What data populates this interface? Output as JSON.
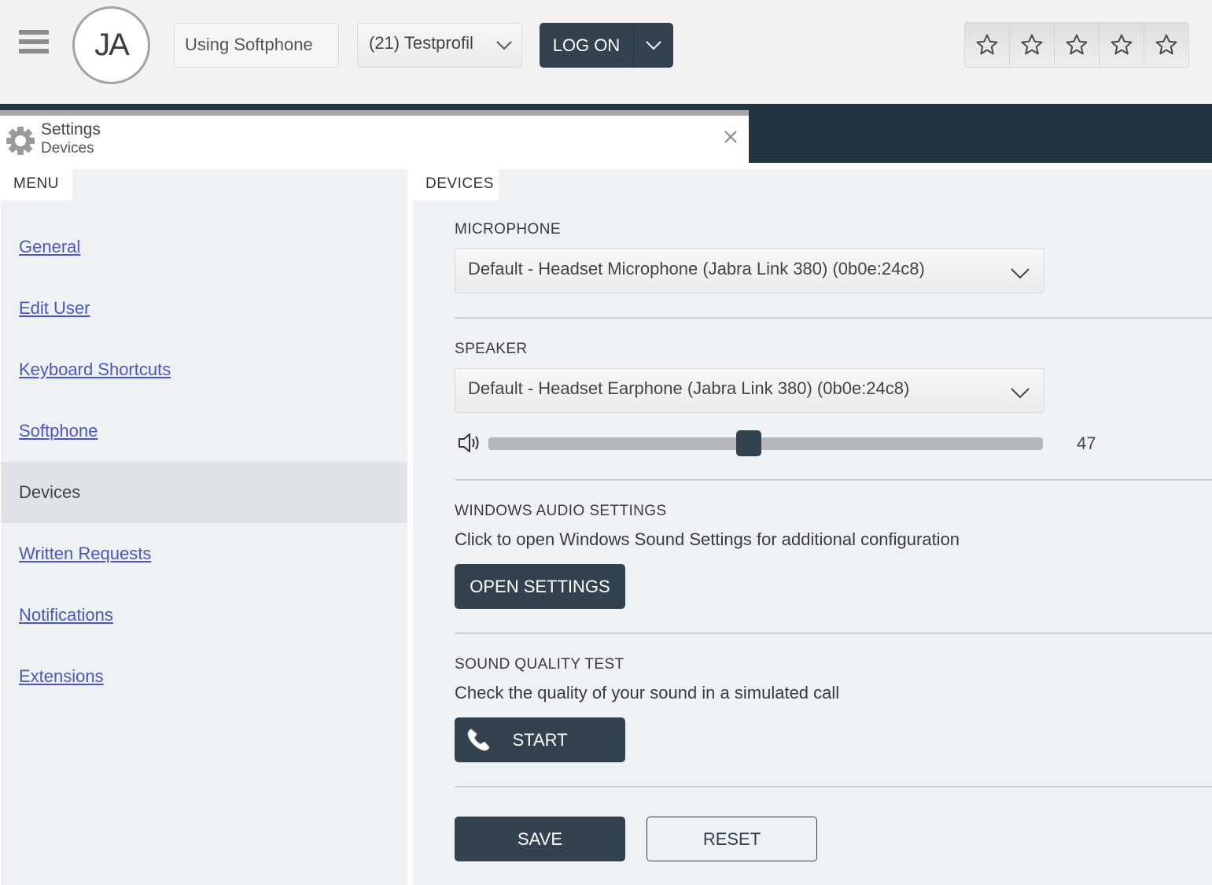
{
  "topbar": {
    "avatar_initials": "JA",
    "status_text": "Using Softphone",
    "profile_select": {
      "selected": "(21) Testprofil"
    },
    "logon_label": "LOG ON",
    "rating": {
      "max": 5,
      "value": 0
    }
  },
  "window": {
    "title": "Settings",
    "subtitle": "Devices",
    "icon": "gear-icon"
  },
  "sidebar": {
    "tab_label": "MENU",
    "items": [
      {
        "label": "General",
        "active": false
      },
      {
        "label": "Edit User",
        "active": false
      },
      {
        "label": "Keyboard Shortcuts",
        "active": false
      },
      {
        "label": "Softphone",
        "active": false
      },
      {
        "label": "Devices",
        "active": true
      },
      {
        "label": "Written Requests",
        "active": false
      },
      {
        "label": "Notifications",
        "active": false
      },
      {
        "label": "Extensions",
        "active": false
      }
    ]
  },
  "content": {
    "tab_label": "DEVICES",
    "microphone": {
      "label": "MICROPHONE",
      "selected": "Default - Headset Microphone (Jabra Link 380) (0b0e:24c8)"
    },
    "speaker": {
      "label": "SPEAKER",
      "selected": "Default - Headset Earphone (Jabra Link 380) (0b0e:24c8)",
      "volume": 47,
      "volume_max": 100
    },
    "windows_audio": {
      "label": "WINDOWS AUDIO SETTINGS",
      "description": "Click to open Windows Sound Settings for additional configuration",
      "button": "OPEN SETTINGS"
    },
    "sound_test": {
      "label": "SOUND QUALITY TEST",
      "description": "Check the quality of your sound in a simulated call",
      "button": "START"
    },
    "save_label": "SAVE",
    "reset_label": "RESET"
  },
  "colors": {
    "primary_dark": "#33424f",
    "band_dark": "#223540",
    "link": "#4a56c4",
    "panel_bg": "#eff2f5",
    "active_item_bg": "#dfe3e7"
  }
}
